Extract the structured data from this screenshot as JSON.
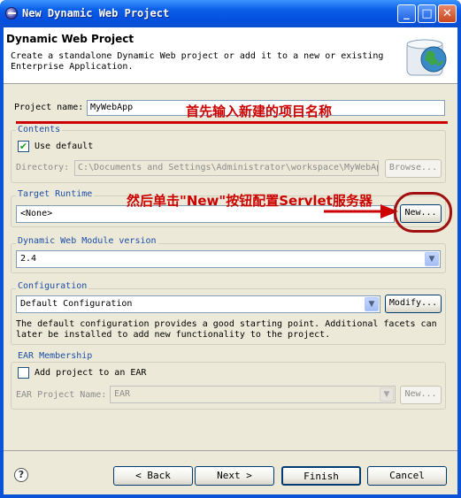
{
  "window": {
    "title": "New Dynamic Web Project"
  },
  "header": {
    "title": "Dynamic Web Project",
    "description": "Create a standalone Dynamic Web project or add it to a new or existing Enterprise Application."
  },
  "project_name": {
    "label": "Project name:",
    "value": "MyWebApp"
  },
  "contents": {
    "title": "Contents",
    "use_default_label": "Use default",
    "use_default_checked": true,
    "directory_label": "Directory:",
    "directory_value": "C:\\Documents and Settings\\Administrator\\workspace\\MyWebAp",
    "browse_label": "Browse..."
  },
  "target_runtime": {
    "title": "Target Runtime",
    "value": "<None>",
    "new_label": "New..."
  },
  "module_version": {
    "title": "Dynamic Web Module version",
    "value": "2.4"
  },
  "configuration": {
    "title": "Configuration",
    "value": "Default Configuration",
    "modify_label": "Modify...",
    "description": "The default configuration provides a good starting point. Additional facets can later be installed to add new functionality to the project."
  },
  "ear": {
    "title": "EAR Membership",
    "add_label": "Add project to an EAR",
    "add_checked": false,
    "project_name_label": "EAR Project Name:",
    "project_name_value": "EAR",
    "new_label": "New..."
  },
  "annotations": {
    "step1": "首先输入新建的项目名称",
    "step2": "然后单击\"New\"按钮配置Servlet服务器"
  },
  "footer": {
    "back": "< Back",
    "next": "Next >",
    "finish": "Finish",
    "cancel": "Cancel"
  },
  "icons": {
    "help": "help-icon",
    "app": "eclipse-icon",
    "banner": "globe-wizard-icon"
  },
  "colors": {
    "annotation": "#cc0000",
    "group_title": "#1c4ea8",
    "titlebar": "#0a5fe8"
  }
}
